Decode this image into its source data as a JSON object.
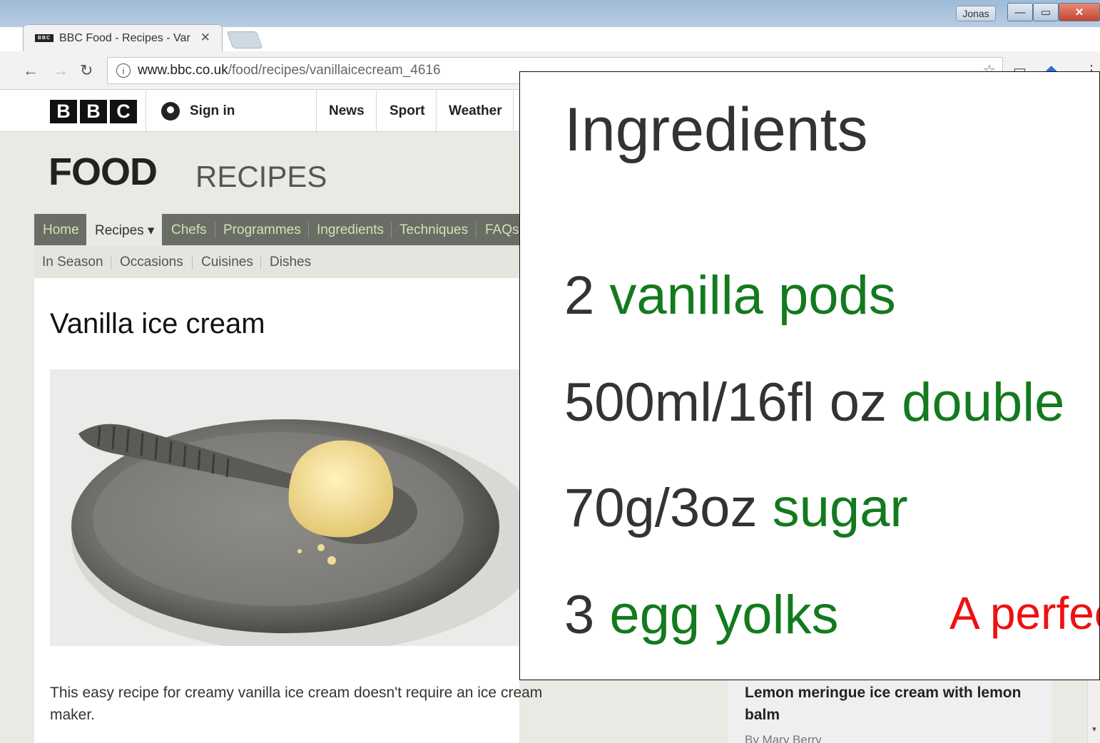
{
  "browser": {
    "tab_title": "BBC Food - Recipes - Var",
    "tab_favicon": "BBC",
    "user_label": "Jonas",
    "url_host": "www.bbc.co.uk",
    "url_path": "/food/recipes/vanillaicecream_4616"
  },
  "bbc_header": {
    "logo": [
      "B",
      "B",
      "C"
    ],
    "sign_in": "Sign in",
    "nav": [
      "News",
      "Sport",
      "Weather"
    ]
  },
  "food_header": {
    "food": "FOOD",
    "recipes": "RECIPES"
  },
  "main_nav": [
    "Home",
    "Recipes ▾",
    "Chefs",
    "Programmes",
    "Ingredients",
    "Techniques",
    "FAQs"
  ],
  "sub_nav": [
    "In Season",
    "Occasions",
    "Cuisines",
    "Dishes"
  ],
  "recipe": {
    "title": "Vanilla ice cream",
    "description": "This easy recipe for creamy vanilla ice cream doesn't require an ice cream maker."
  },
  "sidebar": {
    "title": "Lemon meringue ice cream with lemon balm",
    "author": "By Mary Berry"
  },
  "zoom": {
    "heading": "Ingredients",
    "ingredients": [
      {
        "qty": "2 ",
        "name": "vanilla pods"
      },
      {
        "qty": "500ml/16fl oz ",
        "name": "double"
      },
      {
        "qty": "70g/3oz ",
        "name": "sugar"
      },
      {
        "qty": "3 ",
        "name": "egg yolks"
      }
    ],
    "annotation": "A perfect"
  },
  "colors": {
    "ingredient_name": "#137a1d",
    "annotation": "#ee1111",
    "nav_link": "#cfe3b2"
  }
}
